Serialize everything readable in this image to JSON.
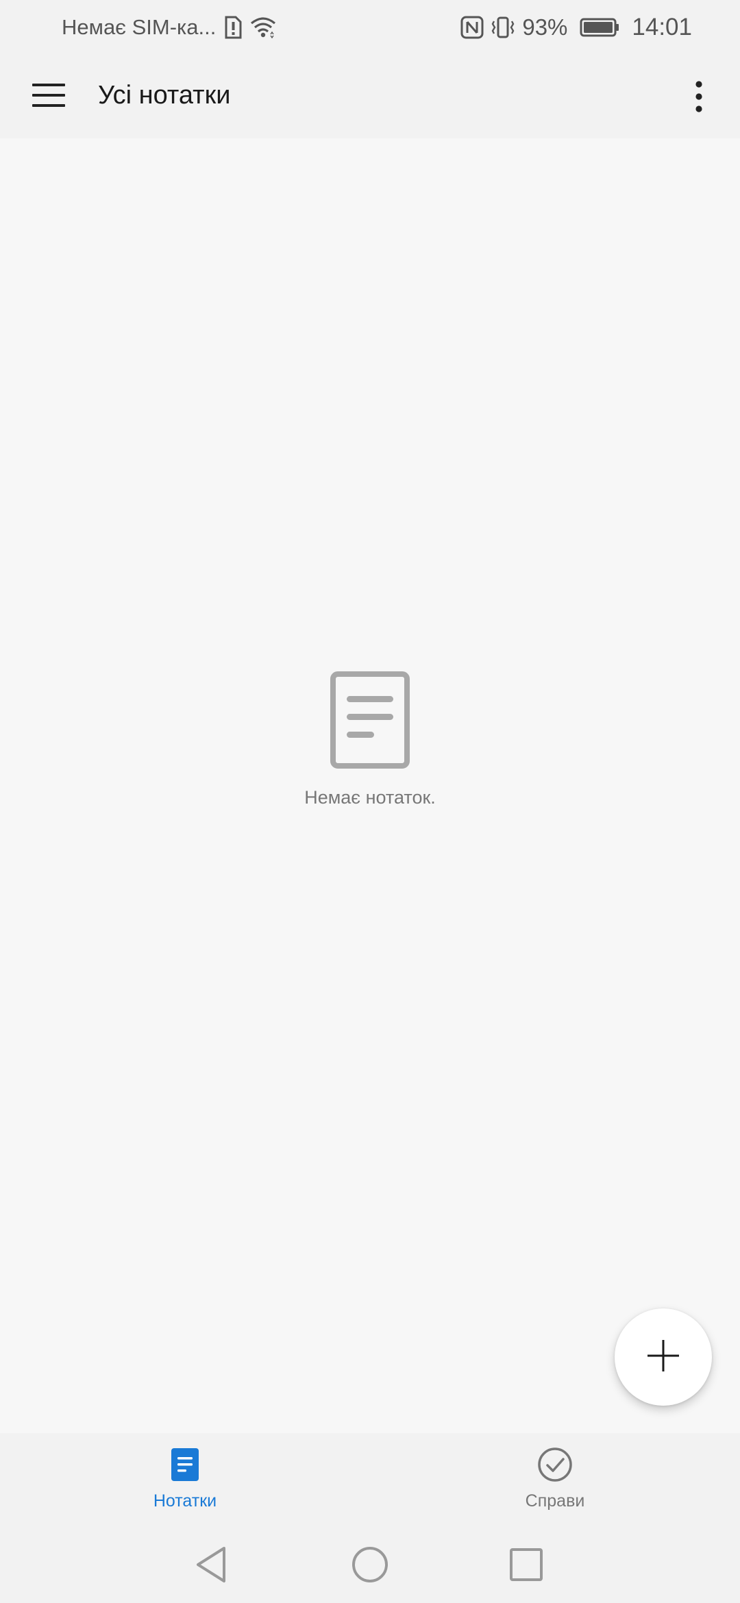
{
  "status_bar": {
    "carrier": "Немає SIM-ка...",
    "battery": "93%",
    "time": "14:01",
    "icons": [
      "sim-alert-icon",
      "wifi-icon",
      "nfc-icon",
      "vibrate-icon",
      "battery-icon"
    ]
  },
  "app_bar": {
    "title": "Усі нотатки",
    "menu_icon": "hamburger-menu-icon",
    "overflow_icon": "more-vert-icon"
  },
  "empty_state": {
    "icon": "note-document-icon",
    "message": "Немає нотаток."
  },
  "fab": {
    "icon": "plus-icon"
  },
  "tabs": [
    {
      "label": "Нотатки",
      "icon": "notes-icon",
      "active": true
    },
    {
      "label": "Справи",
      "icon": "check-circle-icon",
      "active": false
    }
  ],
  "nav_bar": {
    "icons": [
      "back-icon",
      "home-icon",
      "recents-icon"
    ]
  },
  "colors": {
    "accent": "#1a7ad6",
    "background": "#f7f7f7",
    "bar_background": "#f2f2f2",
    "inactive": "#777777"
  }
}
